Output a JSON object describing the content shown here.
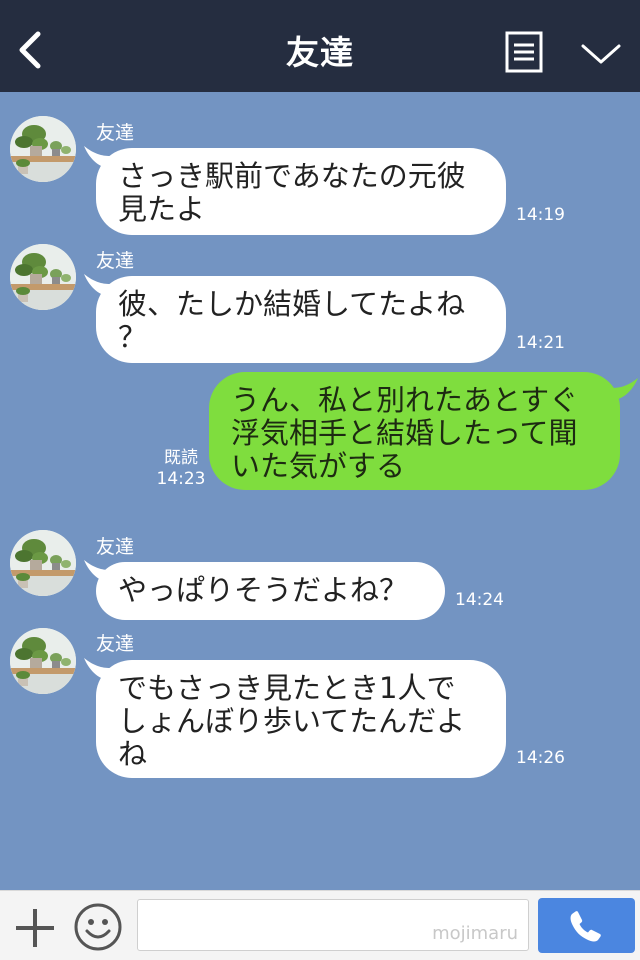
{
  "header": {
    "title": "友達"
  },
  "messages": [
    {
      "sender": "友達",
      "text": "さっき駅前であなたの元彼\n見たよ",
      "time": "14:19"
    },
    {
      "sender": "友達",
      "text": "彼、たしか結婚してたよね\n？",
      "time": "14:21"
    },
    {
      "text": "うん、私と別れたあとすぐ\n浮気相手と結婚したって聞\nいた気がする",
      "read": "既読",
      "time": "14:23"
    },
    {
      "sender": "友達",
      "text": "やっぱりそうだよね？",
      "time": "14:24"
    },
    {
      "sender": "友達",
      "text": "でもさっき見たとき1人で\nしょんぼり歩いてたんだよ\nね",
      "time": "14:26"
    }
  ],
  "footer": {
    "watermark": "mojimaru"
  },
  "icons": [
    "back-icon",
    "menu-icon",
    "chevron-down-icon",
    "plus-icon",
    "emoji-icon",
    "phone-icon"
  ],
  "colors": {
    "header": "#252d40",
    "background": "#7394c2",
    "outgoing_bubble": "#7fdd3e",
    "incoming_bubble": "#ffffff",
    "call_button": "#4b86e0"
  }
}
